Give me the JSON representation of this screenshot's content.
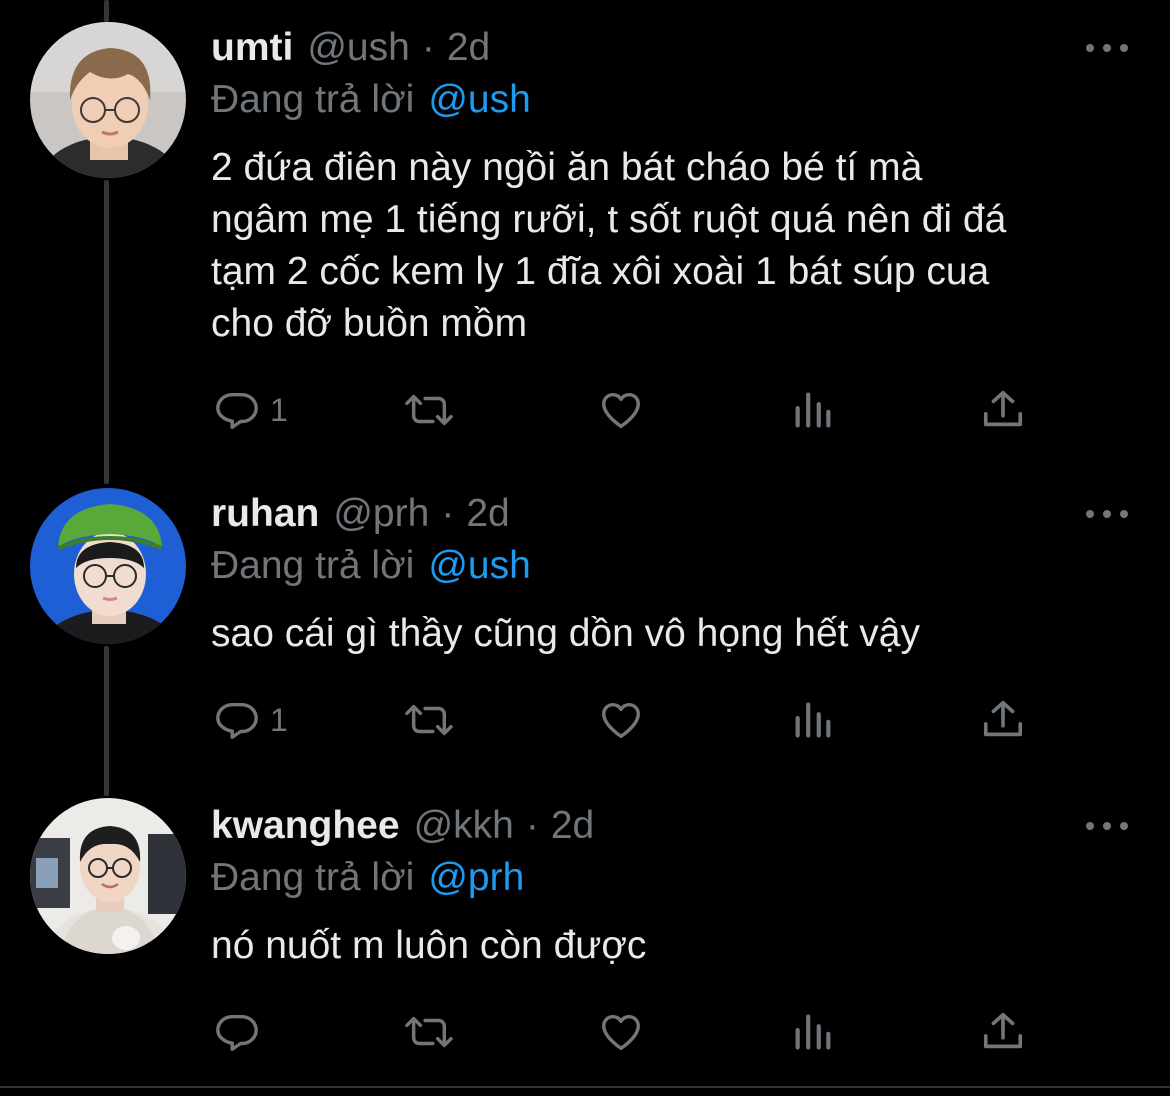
{
  "tweets": [
    {
      "name": "umti",
      "handle": "@ush",
      "dot": "·",
      "time": "2d",
      "replying_label": "Đang trả lời",
      "replying_to": "@ush",
      "text_lines": [
        "2 đứa điên này ngồi ăn bát cháo bé tí mà",
        "ngâm mẹ 1 tiếng rưỡi, t sốt ruột quá nên đi đá",
        "tạm 2 cốc kem ly 1 đĩa xôi xoài 1 bát súp cua",
        "cho đỡ buồn mồm"
      ],
      "reply_count": "1",
      "avatar": "photo-glasses-light-background"
    },
    {
      "name": "ruhan",
      "handle": "@prh",
      "dot": "·",
      "time": "2d",
      "replying_label": "Đang trả lời",
      "replying_to": "@ush",
      "text_lines": [
        "sao cái gì thầy cũng dồn vô họng hết vậy"
      ],
      "reply_count": "1",
      "avatar": "photo-green-hat-blue-background"
    },
    {
      "name": "kwanghee",
      "handle": "@kkh",
      "dot": "·",
      "time": "2d",
      "replying_label": "Đang trả lời",
      "replying_to": "@prh",
      "text_lines": [
        "nó nuốt m luôn còn được"
      ],
      "reply_count": "",
      "avatar": "photo-white-hoodie"
    }
  ],
  "icons": {
    "reply": "reply-bubble-icon",
    "retweet": "retweet-icon",
    "like": "heart-icon",
    "views": "views-bar-chart-icon",
    "share": "share-upload-icon",
    "more": "more-dots-icon"
  },
  "colors": {
    "background": "#000000",
    "text": "#e7e9ea",
    "muted": "#71767b",
    "mention": "#1d9bf0",
    "thread_line": "#333639"
  }
}
